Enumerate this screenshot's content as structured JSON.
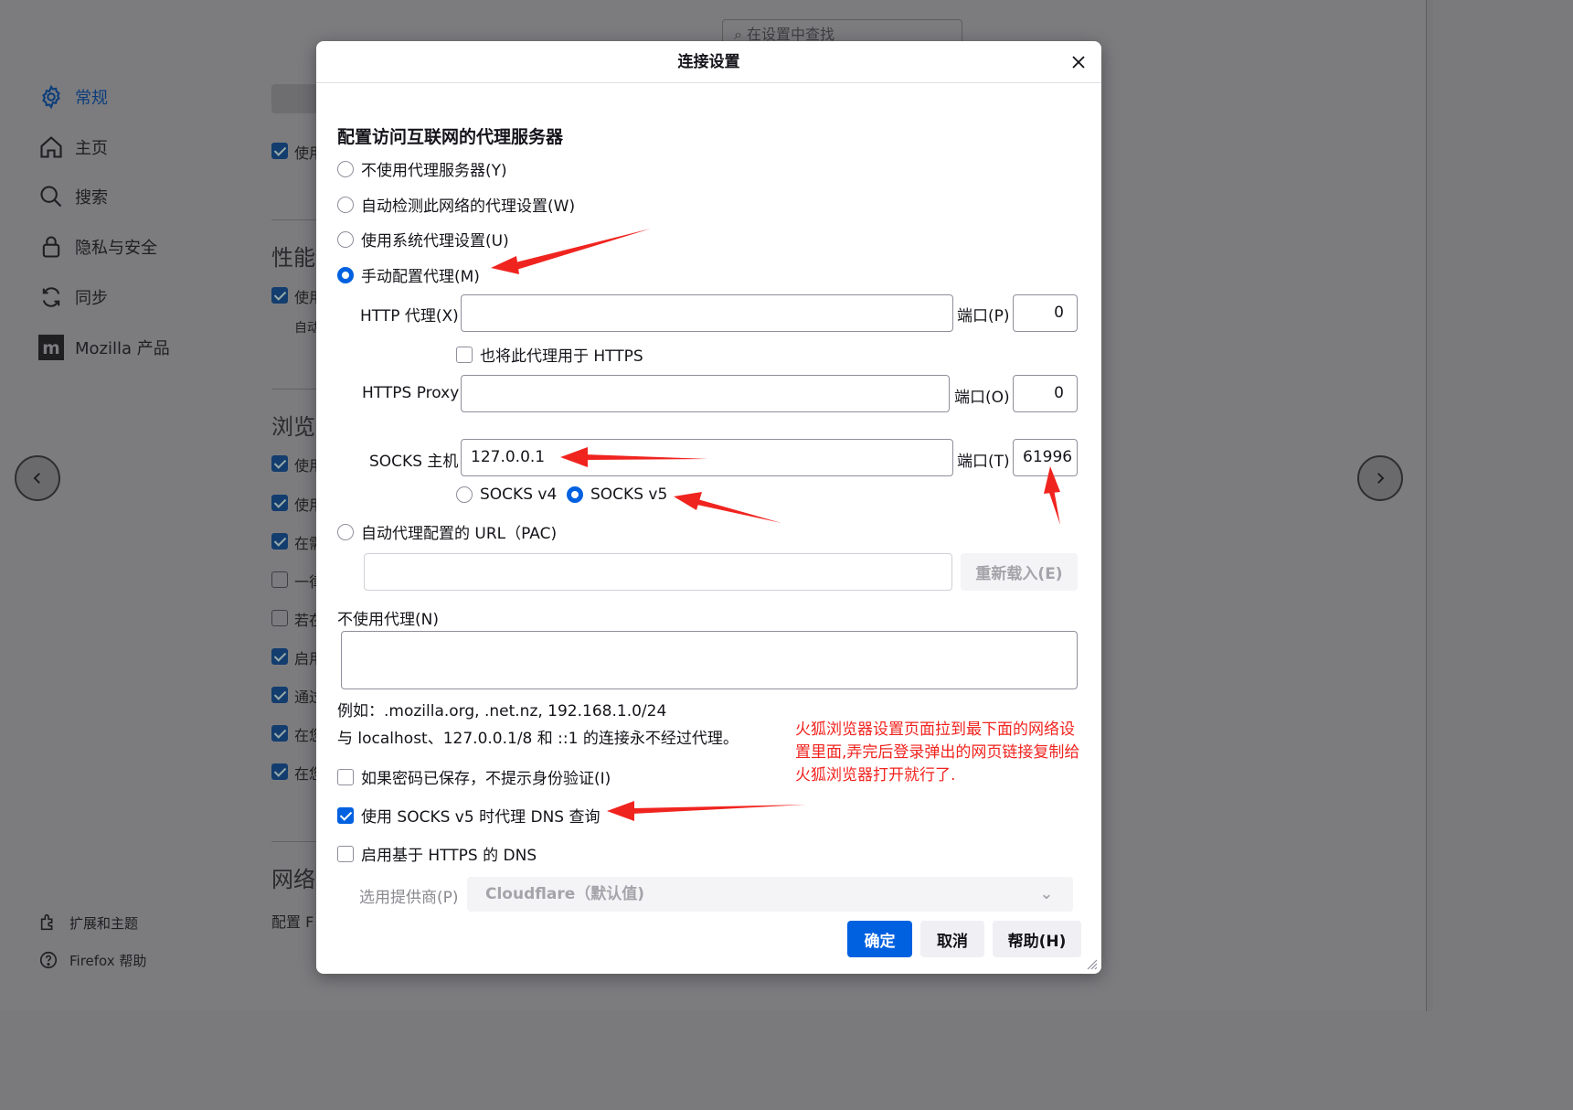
{
  "background": {
    "search_placeholder": "在设置中查找",
    "nav": [
      {
        "label": "常规",
        "icon": "gear-icon"
      },
      {
        "label": "主页",
        "icon": "home-icon"
      },
      {
        "label": "搜索",
        "icon": "search-icon"
      },
      {
        "label": "隐私与安全",
        "icon": "lock-icon"
      },
      {
        "label": "同步",
        "icon": "sync-icon"
      },
      {
        "label": "Mozilla 产品",
        "icon": "mozilla-icon"
      }
    ],
    "footer_nav": [
      {
        "label": "扩展和主题",
        "icon": "puzzle-icon"
      },
      {
        "label": "Firefox 帮助",
        "icon": "help-icon"
      }
    ],
    "sections": [
      "性能",
      "浏览",
      "网络"
    ],
    "partial_texts": [
      "使用",
      "使用",
      "自动",
      "使用",
      "使用",
      "在需",
      "一律",
      "若在",
      "启用",
      "通过",
      "在您",
      "在您",
      "配置 F"
    ]
  },
  "dialog": {
    "title": "连接设置",
    "section_title": "配置访问互联网的代理服务器",
    "proxy_options": [
      {
        "label": "不使用代理服务器(Y)",
        "checked": false
      },
      {
        "label": "自动检测此网络的代理设置(W)",
        "checked": false
      },
      {
        "label": "使用系统代理设置(U)",
        "checked": false
      },
      {
        "label": "手动配置代理(M)",
        "checked": true
      }
    ],
    "http": {
      "label": "HTTP 代理(X)",
      "value": "",
      "port_label": "端口(P)",
      "port": "0"
    },
    "also_https": {
      "label": "也将此代理用于 HTTPS",
      "checked": false
    },
    "https": {
      "label": "HTTPS Proxy",
      "value": "",
      "port_label": "端口(O)",
      "port": "0"
    },
    "socks": {
      "label": "SOCKS 主机",
      "value": "127.0.0.1",
      "port_label": "端口(T)",
      "port": "61996"
    },
    "socks_versions": [
      {
        "label": "SOCKS v4",
        "checked": false
      },
      {
        "label": "SOCKS v5",
        "checked": true
      }
    ],
    "pac": {
      "label": "自动代理配置的 URL（PAC)",
      "value": "",
      "reload_label": "重新载入(E)"
    },
    "no_proxy": {
      "label": "不使用代理(N)",
      "value": ""
    },
    "example_text": "例如：.mozilla.org, .net.nz, 192.168.1.0/24",
    "localhost_text": "与 localhost、127.0.0.1/8 和 ::1 的连接永不经过代理。",
    "no_auth_prompt": {
      "label": "如果密码已保存，不提示身份验证(I)",
      "checked": false
    },
    "socks_dns": {
      "label": "使用 SOCKS v5 时代理 DNS 查询",
      "checked": true
    },
    "https_dns": {
      "label": "启用基于 HTTPS 的 DNS",
      "checked": false
    },
    "provider": {
      "label": "选用提供商(P)",
      "value": "Cloudflare（默认值)"
    },
    "buttons": {
      "ok": "确定",
      "cancel": "取消",
      "help": "帮助(H)"
    }
  },
  "annotation": {
    "note": "火狐浏览器设置页面拉到最下面的网络设置里面,弄完后登录弹出的网页链接复制给火狐浏览器打开就行了.",
    "color": "#f0241f"
  },
  "colors": {
    "accent": "#0061e0",
    "overlay": "#7c7c7f"
  }
}
